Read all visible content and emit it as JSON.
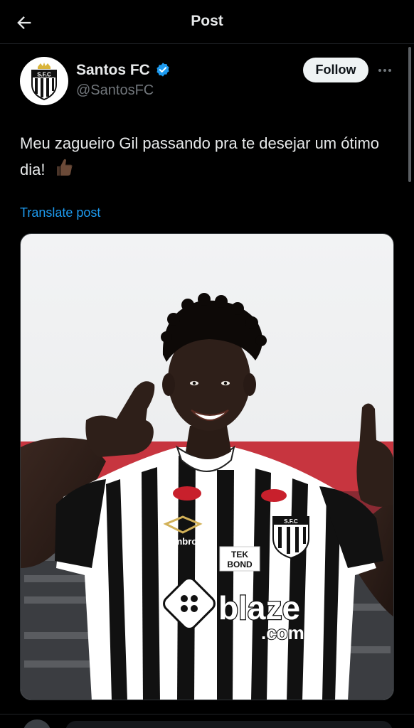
{
  "header": {
    "title": "Post",
    "back_icon": "arrow-left-icon"
  },
  "author": {
    "name": "Santos FC",
    "handle": "@SantosFC",
    "verified": true,
    "avatar_icon": "santos-fc-crest",
    "follow_label": "Follow"
  },
  "post": {
    "text": "Meu zagueiro Gil passando pra te desejar um ótimo dia!",
    "emoji": "thumbs-up-medium-dark-skin-tone",
    "translate_label": "Translate post"
  },
  "media": {
    "jersey_sponsor_text": "blaze",
    "jersey_sponsor_suffix": ".com",
    "jersey_brand": "umbro",
    "jersey_badge_line1": "TEK",
    "jersey_badge_line2": "BOND",
    "crest_text": "S.F.C"
  },
  "colors": {
    "background": "#000000",
    "text_primary": "#e7e9ea",
    "text_secondary": "#71767b",
    "link": "#1d9bf0",
    "verified": "#1d9bf0",
    "follow_bg": "#eff3f4"
  }
}
